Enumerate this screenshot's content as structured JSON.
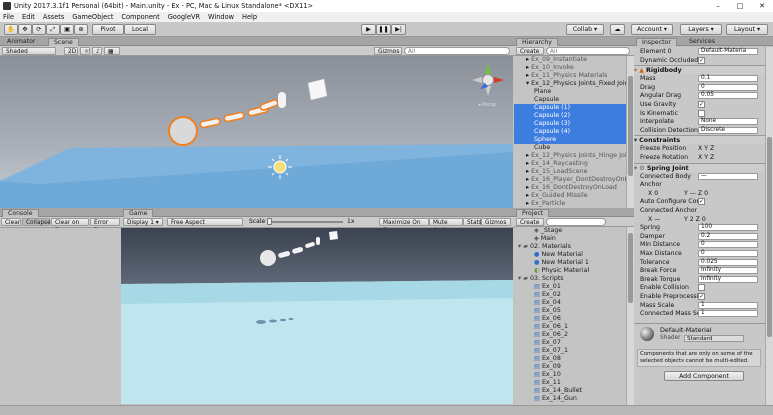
{
  "window": {
    "title": "Unity 2017.3.1f1 Personal (64bit) - Main.unity - Ex - PC, Mac & Linux Standalone* <DX11>",
    "minimize": "–",
    "maximize": "□",
    "close": "✕"
  },
  "menu": [
    "File",
    "Edit",
    "Assets",
    "GameObject",
    "Component",
    "GoogleVR",
    "Window",
    "Help"
  ],
  "toolbar": {
    "pivot": "Pivot",
    "local": "Local",
    "collab": "Collab ▾",
    "account": "Account ▾",
    "layers": "Layers ▾",
    "layout": "Layout ▾"
  },
  "scene": {
    "tabs": [
      "Animator",
      "Scene"
    ],
    "shading": "Shaded",
    "mode2d": "2D",
    "gizmos": "Gizmos ▾",
    "search": "All",
    "persp": "◂ Persp"
  },
  "console": {
    "tab": "Console",
    "buttons": [
      "Clear",
      "Collapse",
      "Clear on Play",
      "Error Paus"
    ]
  },
  "game": {
    "tab": "Game",
    "display": "Display 1 ▾",
    "aspect": "Free Aspect",
    "scale_label": "Scale",
    "scale_value": "1x",
    "buttons": [
      "Maximize On Play",
      "Mute Audio",
      "Stats",
      "Gizmos ▾"
    ]
  },
  "hierarchy": {
    "tab": "Hierarchy",
    "create": "Create ▾",
    "search": "All",
    "items": [
      {
        "label": "Ex_09_Instantiate",
        "indent": 1,
        "sel": false,
        "gray": true
      },
      {
        "label": "Ex_10_Invoke",
        "indent": 1,
        "sel": false,
        "gray": true
      },
      {
        "label": "Ex_11_Physics Materials",
        "indent": 1,
        "sel": false,
        "gray": true
      },
      {
        "label": "Ex_12_Physics Joints_Fixed Joint",
        "indent": 1,
        "sel": false,
        "gray": false,
        "open": true
      },
      {
        "label": "Plane",
        "indent": 2,
        "sel": false,
        "gray": false
      },
      {
        "label": "Capsule",
        "indent": 2,
        "sel": false,
        "gray": false
      },
      {
        "label": "Capsule (1)",
        "indent": 2,
        "sel": true,
        "gray": false
      },
      {
        "label": "Capsule (2)",
        "indent": 2,
        "sel": true,
        "gray": false
      },
      {
        "label": "Capsule (3)",
        "indent": 2,
        "sel": true,
        "gray": false
      },
      {
        "label": "Capsule (4)",
        "indent": 2,
        "sel": true,
        "gray": false
      },
      {
        "label": "Sphere",
        "indent": 2,
        "sel": true,
        "gray": false
      },
      {
        "label": "Cube",
        "indent": 2,
        "sel": false,
        "gray": false
      },
      {
        "label": "Ex_12_Physics Joints_Hinge Joint",
        "indent": 1,
        "sel": false,
        "gray": true
      },
      {
        "label": "Ex_14_Raycasting",
        "indent": 1,
        "sel": false,
        "gray": true
      },
      {
        "label": "Ex_15_LoadScene",
        "indent": 1,
        "sel": false,
        "gray": true
      },
      {
        "label": "Ex_16_Player_DontDestroyOnLo",
        "indent": 1,
        "sel": false,
        "gray": true
      },
      {
        "label": "Ex_16_DontDestroyOnLoad",
        "indent": 1,
        "sel": false,
        "gray": true
      },
      {
        "label": "Ex_Guided Missile",
        "indent": 1,
        "sel": false,
        "gray": true
      },
      {
        "label": "Ex_Particle",
        "indent": 1,
        "sel": false,
        "gray": true
      }
    ]
  },
  "project": {
    "tab": "Project",
    "create": "Create ▾",
    "items": [
      {
        "label": "_Stage",
        "indent": 2,
        "icon": "scene"
      },
      {
        "label": "Main",
        "indent": 2,
        "icon": "scene"
      },
      {
        "label": "02. Materials",
        "indent": 0,
        "icon": "folder"
      },
      {
        "label": "New Material",
        "indent": 2,
        "icon": "mat"
      },
      {
        "label": "New Material 1",
        "indent": 2,
        "icon": "mat"
      },
      {
        "label": "Physic Material",
        "indent": 2,
        "icon": "physmat"
      },
      {
        "label": "03. Scripts",
        "indent": 0,
        "icon": "folder"
      },
      {
        "label": "Ex_01",
        "indent": 2,
        "icon": "script"
      },
      {
        "label": "Ex_02",
        "indent": 2,
        "icon": "script"
      },
      {
        "label": "Ex_04",
        "indent": 2,
        "icon": "script"
      },
      {
        "label": "Ex_05",
        "indent": 2,
        "icon": "script"
      },
      {
        "label": "Ex_06",
        "indent": 2,
        "icon": "script"
      },
      {
        "label": "Ex_06_1",
        "indent": 2,
        "icon": "script"
      },
      {
        "label": "Ex_06_2",
        "indent": 2,
        "icon": "script"
      },
      {
        "label": "Ex_07",
        "indent": 2,
        "icon": "script"
      },
      {
        "label": "Ex_07_1",
        "indent": 2,
        "icon": "script"
      },
      {
        "label": "Ex_08",
        "indent": 2,
        "icon": "script"
      },
      {
        "label": "Ex_09",
        "indent": 2,
        "icon": "script"
      },
      {
        "label": "Ex_10",
        "indent": 2,
        "icon": "script"
      },
      {
        "label": "Ex_11",
        "indent": 2,
        "icon": "script"
      },
      {
        "label": "Ex_14_Bullet",
        "indent": 2,
        "icon": "script"
      },
      {
        "label": "Ex_14_Gun",
        "indent": 2,
        "icon": "script"
      }
    ]
  },
  "inspector": {
    "tabs": [
      "Inspector",
      "Services"
    ],
    "top": [
      {
        "label": "Element 0",
        "value": "Default-Materia",
        "type": "field"
      },
      {
        "label": "Dynamic Occluded",
        "value": "✓",
        "type": "check"
      }
    ],
    "rigidbody_title": "Rigidbody",
    "rigidbody": [
      {
        "label": "Mass",
        "value": "0.1",
        "type": "field"
      },
      {
        "label": "Drag",
        "value": "0",
        "type": "field"
      },
      {
        "label": "Angular Drag",
        "value": "0.05",
        "type": "field"
      },
      {
        "label": "Use Gravity",
        "value": "✓",
        "type": "check"
      },
      {
        "label": "Is Kinematic",
        "value": "",
        "type": "check"
      },
      {
        "label": "Interpolate",
        "value": "None",
        "type": "field"
      },
      {
        "label": "Collision Detection",
        "value": "Discrete",
        "type": "field"
      }
    ],
    "constraints_title": "Constraints",
    "constraints": [
      {
        "label": "Freeze Position",
        "value": "X  Y  Z"
      },
      {
        "label": "Freeze Rotation",
        "value": "X  Y  Z"
      }
    ],
    "spring_title": "Spring Joint",
    "spring": [
      {
        "label": "Connected Body",
        "value": "—",
        "type": "field"
      },
      {
        "label": "Anchor",
        "value": "",
        "type": "none"
      },
      {
        "label": "X 0",
        "value": "Y —   Z 0",
        "type": "vec"
      },
      {
        "label": "Auto Configure Conn",
        "value": "✓",
        "type": "check"
      },
      {
        "label": "Connected Anchor",
        "value": "",
        "type": "none"
      },
      {
        "label": "X —",
        "value": "Y 2   Z 0",
        "type": "vec"
      },
      {
        "label": "Spring",
        "value": "100",
        "type": "field"
      },
      {
        "label": "Damper",
        "value": "0.2",
        "type": "field"
      },
      {
        "label": "Min Distance",
        "value": "0",
        "type": "field"
      },
      {
        "label": "Max Distance",
        "value": "0",
        "type": "field"
      },
      {
        "label": "Tolerance",
        "value": "0.025",
        "type": "field"
      },
      {
        "label": "Break Force",
        "value": "Infinity",
        "type": "field"
      },
      {
        "label": "Break Torque",
        "value": "Infinity",
        "type": "field"
      },
      {
        "label": "Enable Collision",
        "value": "",
        "type": "check"
      },
      {
        "label": "Enable Preprocessin",
        "value": "✓",
        "type": "check"
      },
      {
        "label": "Mass Scale",
        "value": "1",
        "type": "field"
      },
      {
        "label": "Connected Mass Sca",
        "value": "1",
        "type": "field"
      }
    ],
    "material_name": "Default-Material",
    "shader_label": "Shader",
    "shader_value": "Standard",
    "note": "Components that are only on some of the selected objects cannot be multi-edited.",
    "add_component": "Add Component"
  },
  "colors": {
    "selection": "#3e7de0",
    "orange": "#f08020",
    "ground": "#6aa7d8"
  }
}
